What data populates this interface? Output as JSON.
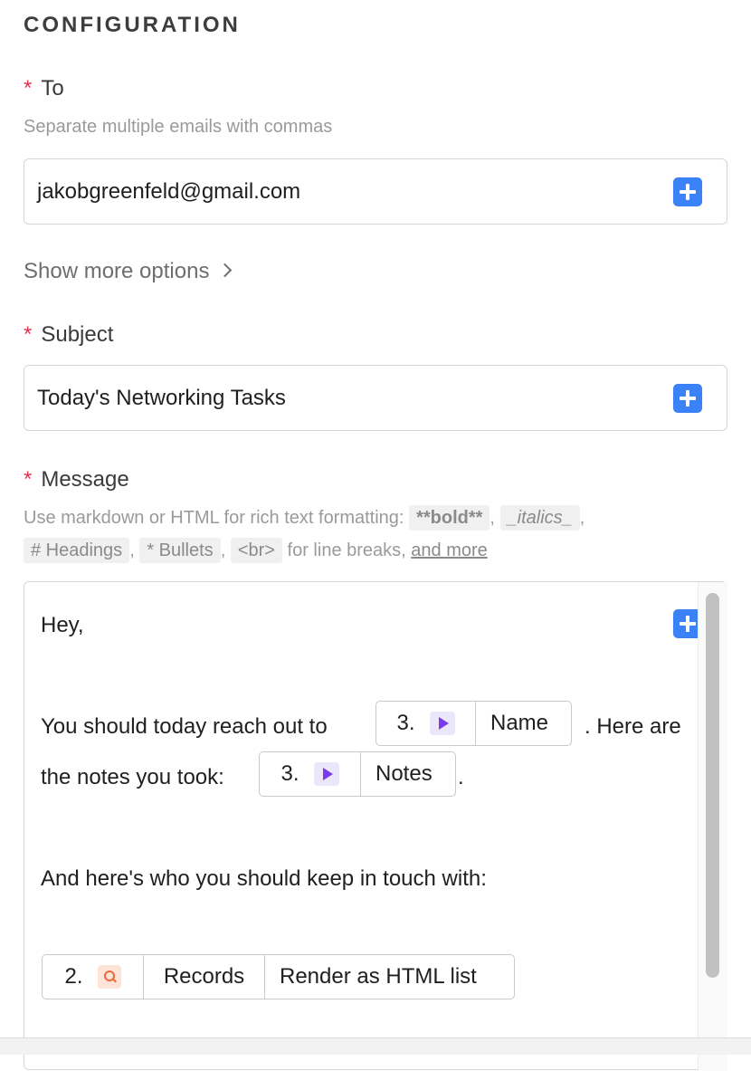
{
  "section": {
    "title": "CONFIGURATION"
  },
  "to": {
    "required_mark": "*",
    "label": "To",
    "hint": "Separate multiple emails with commas",
    "value": "jakobgreenfeld@gmail.com"
  },
  "show_more": {
    "label": "Show more options"
  },
  "subject": {
    "required_mark": "*",
    "label": "Subject",
    "value": "Today's Networking Tasks"
  },
  "message": {
    "required_mark": "*",
    "label": "Message",
    "hint": {
      "prefix": "Use markdown or HTML for rich text formatting:",
      "bold": "**bold**",
      "sep1": ",",
      "italics": "_italics_",
      "sep2": ",",
      "headings": "# Headings",
      "sep3": ",",
      "bullets": "* Bullets",
      "sep4": ",",
      "br": "<br>",
      "suffix": "for line breaks,",
      "more_link": "and more"
    },
    "lines": {
      "greeting": "Hey,",
      "line1_before": "You should today reach out to",
      "line1_after": ". Here are",
      "line2_before": "the notes you took:",
      "line2_after": ".",
      "line3": "And here's who you should keep in touch with:"
    },
    "tokens": {
      "name": {
        "step": "3.",
        "field": "Name"
      },
      "notes": {
        "step": "3.",
        "field": "Notes"
      },
      "records": {
        "step": "2.",
        "field": "Records",
        "format": "Render as HTML list"
      }
    }
  },
  "icons": {
    "insert_data": "plus-icon",
    "chevron": "chevron-right-icon",
    "step_run": "play-icon",
    "step_search": "search-icon"
  },
  "colors": {
    "required": "#e0344e",
    "accent": "#3b82f6",
    "play": "#7c3aed",
    "search": "#f06a3b"
  }
}
